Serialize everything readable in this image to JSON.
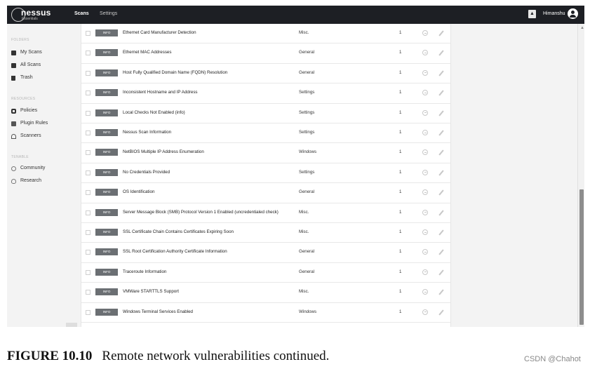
{
  "topbar": {
    "logo_name": "nessus",
    "logo_sub": "Essentials",
    "nav_scans": "Scans",
    "nav_settings": "Settings",
    "user_name": "Himanshu"
  },
  "sidebar": {
    "folders_title": "FOLDERS",
    "folders": [
      {
        "label": "My Scans",
        "icon": "folder-icon"
      },
      {
        "label": "All Scans",
        "icon": "folder-icon"
      },
      {
        "label": "Trash",
        "icon": "trash-icon"
      }
    ],
    "resources_title": "RESOURCES",
    "resources": [
      {
        "label": "Policies",
        "icon": "policy-icon"
      },
      {
        "label": "Plugin Rules",
        "icon": "plugin-icon"
      },
      {
        "label": "Scanners",
        "icon": "scanner-icon"
      }
    ],
    "tenable_title": "TENABLE",
    "tenable": [
      {
        "label": "Community",
        "icon": "community-icon"
      },
      {
        "label": "Research",
        "icon": "research-icon"
      }
    ]
  },
  "table": {
    "rows": [
      {
        "severity": "INFO",
        "name": "Ethernet Card Manufacturer Detection",
        "family": "Misc.",
        "count": "1"
      },
      {
        "severity": "INFO",
        "name": "Ethernet MAC Addresses",
        "family": "General",
        "count": "1"
      },
      {
        "severity": "INFO",
        "name": "Host Fully Qualified Domain Name (FQDN) Resolution",
        "family": "General",
        "count": "1"
      },
      {
        "severity": "INFO",
        "name": "Inconsistent Hostname and IP Address",
        "family": "Settings",
        "count": "1"
      },
      {
        "severity": "INFO",
        "name": "Local Checks Not Enabled (info)",
        "family": "Settings",
        "count": "1"
      },
      {
        "severity": "INFO",
        "name": "Nessus Scan Information",
        "family": "Settings",
        "count": "1"
      },
      {
        "severity": "INFO",
        "name": "NetBIOS Multiple IP Address Enumeration",
        "family": "Windows",
        "count": "1"
      },
      {
        "severity": "INFO",
        "name": "No Credentials Provided",
        "family": "Settings",
        "count": "1"
      },
      {
        "severity": "INFO",
        "name": "OS Identification",
        "family": "General",
        "count": "1"
      },
      {
        "severity": "INFO",
        "name": "Server Message Block (SMB) Protocol Version 1 Enabled (uncredentialed check)",
        "family": "Misc.",
        "count": "1"
      },
      {
        "severity": "INFO",
        "name": "SSL Certificate Chain Contains Certificates Expiring Soon",
        "family": "Misc.",
        "count": "1"
      },
      {
        "severity": "INFO",
        "name": "SSL Root Certification Authority Certificate Information",
        "family": "General",
        "count": "1"
      },
      {
        "severity": "INFO",
        "name": "Traceroute Information",
        "family": "General",
        "count": "1"
      },
      {
        "severity": "INFO",
        "name": "VMWare STARTTLS Support",
        "family": "Misc.",
        "count": "1"
      },
      {
        "severity": "INFO",
        "name": "Windows Terminal Services Enabled",
        "family": "Windows",
        "count": "1"
      }
    ]
  },
  "caption": {
    "label": "FIGURE 10.10",
    "text": "Remote network vulnerabilities continued."
  },
  "watermark": "CSDN @Chahot",
  "colors": {
    "topbar": "#1d1f24",
    "info_badge": "#6b6f73",
    "sidebar_bg": "#f3f3f3"
  }
}
